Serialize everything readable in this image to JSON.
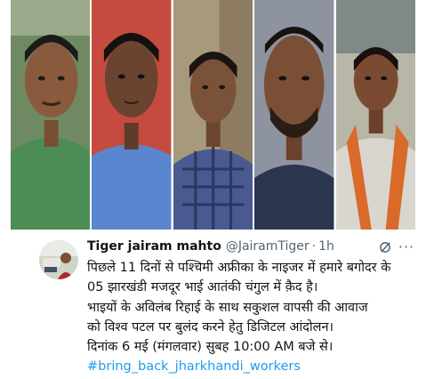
{
  "collage": {
    "photos": [
      {
        "name": "photo-worker-1",
        "bg": "#6f8a63",
        "shirt": "#4c8d55",
        "skin": "#8a5a3e"
      },
      {
        "name": "photo-worker-2",
        "bg": "#c64b3f",
        "shirt": "#5a86cf",
        "skin": "#6a4430"
      },
      {
        "name": "photo-worker-3",
        "bg": "#a79a7c",
        "shirt": "#4a5a90",
        "skin": "#7a5139"
      },
      {
        "name": "photo-worker-4",
        "bg": "#8e93a0",
        "shirt": "#2b3550",
        "skin": "#7a4f36"
      },
      {
        "name": "photo-worker-5",
        "bg": "#b8b6a6",
        "shirt": "#d9d6cf",
        "skin": "#7a4b32",
        "scarf": "#d96a2a"
      }
    ]
  },
  "tweet": {
    "author_name": "Tiger jairam mahto",
    "handle": "@JairamTiger",
    "separator": "·",
    "time": "1h",
    "more": "···",
    "lines": [
      "पिछले 11 दिनों से पश्चिमी अफ्रीका के नाइजर में हमारे बगोदर के",
      "05 झारखंडी मजदूर भाई आतंकी चंगुल में क़ैद है।",
      "भाइयों के अविलंब रिहाई के साथ सकुशल वापसी की आवाज",
      "को विश्व पटल पर बुलंद करने हेतु डिजिटल आंदोलन।",
      "दिनांक 6 मई (मंगलवार) सुबह 10:00 AM बजे से।"
    ],
    "hashtag": "#bring_back_jharkhandi_workers"
  },
  "colors": {
    "text": "#0f1419",
    "muted": "#536471",
    "link": "#1d9bf0"
  }
}
